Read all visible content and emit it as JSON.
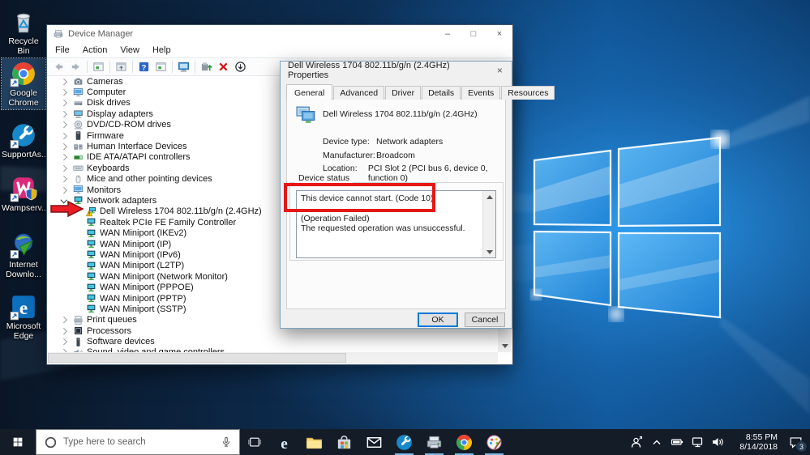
{
  "colors": {
    "accent": "#0078d7",
    "taskbar_background": "#141c28",
    "annotation_red": "#e51717",
    "warning_yellow": "#fdd017",
    "wallpaper_blue": "#2f9ff2"
  },
  "desktop": {
    "icons": [
      {
        "name": "recycle-bin",
        "label": "Recycle Bin",
        "selected": false
      },
      {
        "name": "chrome",
        "label": "Google Chrome",
        "selected": true
      },
      {
        "name": "supportassist",
        "label": "SupportAs...",
        "selected": false
      },
      {
        "name": "wamp",
        "label": "Wampserv...",
        "selected": false
      },
      {
        "name": "idm",
        "label": "Internet Downlo...",
        "selected": false
      },
      {
        "name": "edge",
        "label": "Microsoft Edge",
        "selected": false
      }
    ]
  },
  "device_manager": {
    "title": "Device Manager",
    "window_buttons": [
      "minimize",
      "maximize",
      "close"
    ],
    "menu": [
      "File",
      "Action",
      "View",
      "Help"
    ],
    "toolbar_icons": [
      "back",
      "forward",
      "sep",
      "console",
      "sep",
      "export",
      "sep",
      "help",
      "console",
      "sep",
      "remote-desktop",
      "sep",
      "update-driver",
      "uninstall",
      "disable-device"
    ],
    "tree": [
      {
        "label": "Cameras",
        "icon": "camera",
        "level": 0,
        "state": "collapsed"
      },
      {
        "label": "Computer",
        "icon": "computer",
        "level": 0,
        "state": "collapsed"
      },
      {
        "label": "Disk drives",
        "icon": "disk",
        "level": 0,
        "state": "collapsed"
      },
      {
        "label": "Display adapters",
        "icon": "display",
        "level": 0,
        "state": "collapsed"
      },
      {
        "label": "DVD/CD-ROM drives",
        "icon": "dvd",
        "level": 0,
        "state": "collapsed"
      },
      {
        "label": "Firmware",
        "icon": "firmware",
        "level": 0,
        "state": "collapsed"
      },
      {
        "label": "Human Interface Devices",
        "icon": "hid",
        "level": 0,
        "state": "collapsed"
      },
      {
        "label": "IDE ATA/ATAPI controllers",
        "icon": "ide",
        "level": 0,
        "state": "collapsed"
      },
      {
        "label": "Keyboards",
        "icon": "keyboard",
        "level": 0,
        "state": "collapsed"
      },
      {
        "label": "Mice and other pointing devices",
        "icon": "mouse",
        "level": 0,
        "state": "collapsed"
      },
      {
        "label": "Monitors",
        "icon": "computer",
        "level": 0,
        "state": "collapsed"
      },
      {
        "label": "Network adapters",
        "icon": "network",
        "level": 0,
        "state": "expanded"
      },
      {
        "label": "Dell Wireless 1704 802.11b/g/n (2.4GHz)",
        "icon": "network-warning",
        "level": 1,
        "pointed_by_arrow": true
      },
      {
        "label": "Realtek PCIe FE Family Controller",
        "icon": "network",
        "level": 1
      },
      {
        "label": "WAN Miniport (IKEv2)",
        "icon": "network",
        "level": 1
      },
      {
        "label": "WAN Miniport (IP)",
        "icon": "network",
        "level": 1
      },
      {
        "label": "WAN Miniport (IPv6)",
        "icon": "network",
        "level": 1
      },
      {
        "label": "WAN Miniport (L2TP)",
        "icon": "network",
        "level": 1
      },
      {
        "label": "WAN Miniport (Network Monitor)",
        "icon": "network",
        "level": 1
      },
      {
        "label": "WAN Miniport (PPPOE)",
        "icon": "network",
        "level": 1
      },
      {
        "label": "WAN Miniport (PPTP)",
        "icon": "network",
        "level": 1
      },
      {
        "label": "WAN Miniport (SSTP)",
        "icon": "network",
        "level": 1
      },
      {
        "label": "Print queues",
        "icon": "printer",
        "level": 0,
        "state": "collapsed"
      },
      {
        "label": "Processors",
        "icon": "processor",
        "level": 0,
        "state": "collapsed"
      },
      {
        "label": "Software devices",
        "icon": "software",
        "level": 0,
        "state": "collapsed"
      },
      {
        "label": "Sound, video and game controllers",
        "icon": "sound",
        "level": 0,
        "state": "collapsed"
      }
    ]
  },
  "properties_dialog": {
    "title": "Dell Wireless 1704 802.11b/g/n (2.4GHz) Properties",
    "tabs": [
      "General",
      "Advanced",
      "Driver",
      "Details",
      "Events",
      "Resources"
    ],
    "active_tab": "General",
    "device_name": "Dell Wireless 1704 802.11b/g/n (2.4GHz)",
    "fields": [
      {
        "label": "Device type:",
        "value": "Network adapters"
      },
      {
        "label": "Manufacturer:",
        "value": "Broadcom"
      },
      {
        "label": "Location:",
        "value": "PCI Slot 2 (PCI bus 6, device 0, function 0)"
      }
    ],
    "status_label": "Device status",
    "status_lines": [
      "This device cannot start. (Code 10)",
      "",
      "(Operation Failed)",
      "The requested operation was unsuccessful."
    ],
    "highlighted_line": "This device cannot start. (Code 10)",
    "buttons": [
      {
        "label": "OK",
        "default": true
      },
      {
        "label": "Cancel",
        "default": false
      }
    ]
  },
  "taskbar": {
    "search": {
      "placeholder": "Type here to search"
    },
    "apps": [
      {
        "name": "edge",
        "running": false
      },
      {
        "name": "file-explorer",
        "running": false
      },
      {
        "name": "store",
        "running": false
      },
      {
        "name": "mail",
        "running": false
      },
      {
        "name": "supportassist",
        "running": true
      },
      {
        "name": "device-manager",
        "running": true
      },
      {
        "name": "chrome",
        "running": true
      },
      {
        "name": "paint",
        "running": true
      }
    ],
    "tray_icons": [
      "people",
      "chevron-up",
      "battery",
      "network",
      "volume"
    ],
    "clock": {
      "time": "8:55 PM",
      "date": "8/14/2018"
    },
    "notification_badge": "3"
  }
}
